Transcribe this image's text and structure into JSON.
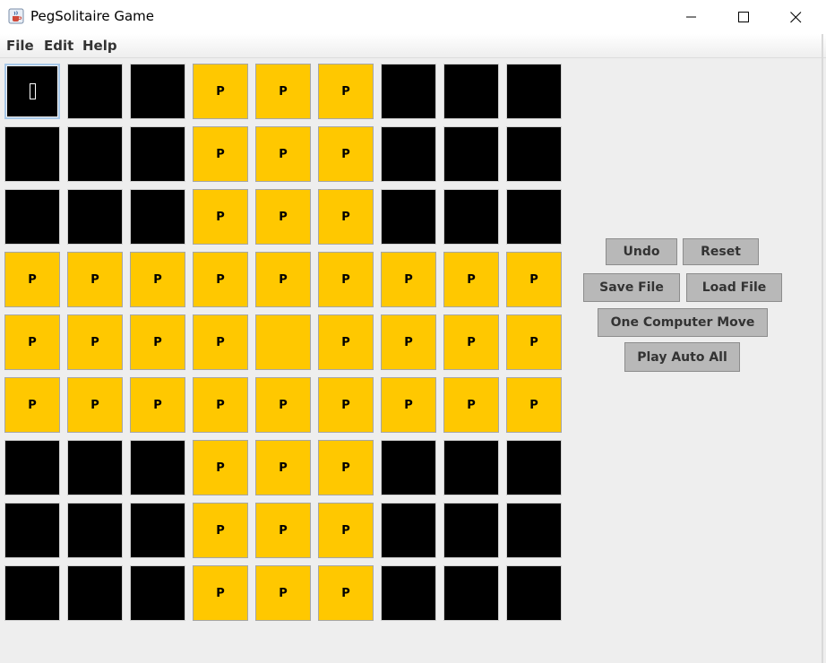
{
  "window": {
    "title": "PegSolitaire Game",
    "icon": "java-cup-icon",
    "controls": [
      "minimize-icon",
      "maximize-icon",
      "close-icon"
    ]
  },
  "menu": [
    "File",
    "Edit",
    "Help"
  ],
  "board": {
    "peg_label": "P",
    "rows": [
      [
        "focus",
        "black",
        "black",
        "peg",
        "peg",
        "peg",
        "black",
        "black",
        "black"
      ],
      [
        "black",
        "black",
        "black",
        "peg",
        "peg",
        "peg",
        "black",
        "black",
        "black"
      ],
      [
        "black",
        "black",
        "black",
        "peg",
        "peg",
        "peg",
        "black",
        "black",
        "black"
      ],
      [
        "peg",
        "peg",
        "peg",
        "peg",
        "peg",
        "peg",
        "peg",
        "peg",
        "peg"
      ],
      [
        "peg",
        "peg",
        "peg",
        "peg",
        "empty",
        "peg",
        "peg",
        "peg",
        "peg"
      ],
      [
        "peg",
        "peg",
        "peg",
        "peg",
        "peg",
        "peg",
        "peg",
        "peg",
        "peg"
      ],
      [
        "black",
        "black",
        "black",
        "peg",
        "peg",
        "peg",
        "black",
        "black",
        "black"
      ],
      [
        "black",
        "black",
        "black",
        "peg",
        "peg",
        "peg",
        "black",
        "black",
        "black"
      ],
      [
        "black",
        "black",
        "black",
        "peg",
        "peg",
        "peg",
        "black",
        "black",
        "black"
      ]
    ],
    "colors": {
      "peg": "#ffc800",
      "blocked": "#000000"
    }
  },
  "buttons": {
    "undo": "Undo",
    "reset": "Reset",
    "save_file": "Save File",
    "load_file": "Load File",
    "one_computer_move": "One Computer Move",
    "play_auto_all": "Play Auto All"
  }
}
